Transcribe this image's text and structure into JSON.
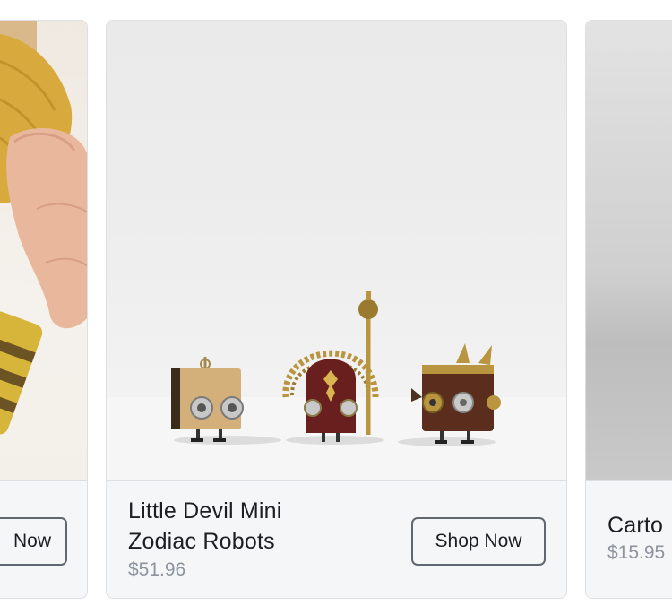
{
  "carousel": {
    "cards": [
      {
        "name": "",
        "price": "",
        "button_label": "Now",
        "image_alt": "hand holding knitted yellow item"
      },
      {
        "name": "Little Devil Mini Zodiac Robots",
        "price": "$51.96",
        "button_label": "Shop Now",
        "image_alt": "three small steampunk robot figurines"
      },
      {
        "name": "Carto",
        "price": "$15.95",
        "button_label": "",
        "image_alt": "grey product photo"
      }
    ]
  },
  "colors": {
    "card_background": "#f5f6f7",
    "card_border": "#dddfe2",
    "title_text": "#1c1e21",
    "price_text": "#8d949e",
    "button_border": "#606770"
  }
}
